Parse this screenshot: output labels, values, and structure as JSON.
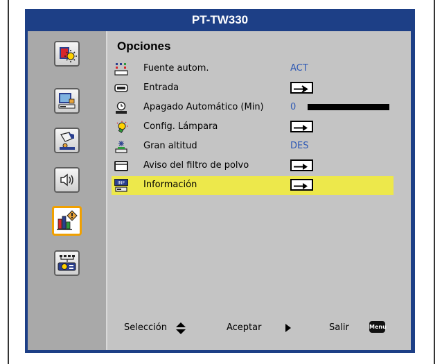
{
  "window": {
    "title": "PT-TW330"
  },
  "panel": {
    "title": "Opciones"
  },
  "sidebar": {
    "items": [
      {
        "name": "image-icon"
      },
      {
        "name": "display-icon"
      },
      {
        "name": "setup-icon"
      },
      {
        "name": "audio-icon"
      },
      {
        "name": "options-icon",
        "active": true
      },
      {
        "name": "network-icon"
      }
    ]
  },
  "menu": {
    "rows": [
      {
        "label": "Fuente autom.",
        "value": "ACT"
      },
      {
        "label": "Entrada"
      },
      {
        "label": "Apagado Automático (Min)",
        "value": "0",
        "level": 0
      },
      {
        "label": "Config. Lámpara"
      },
      {
        "label": "Gran altitud",
        "value": "DES"
      },
      {
        "label": "Aviso del filtro de polvo"
      },
      {
        "label": "Información",
        "icon_text": "INF",
        "highlighted": true
      }
    ]
  },
  "footer": {
    "select_label": "Selección",
    "accept_label": "Aceptar",
    "exit_label": "Salir",
    "menu_key": "Menu"
  },
  "colors": {
    "frame": "#1d3f86",
    "highlight": "#ede84b",
    "value_text": "#2d58b4",
    "active_border": "#f0a000"
  }
}
